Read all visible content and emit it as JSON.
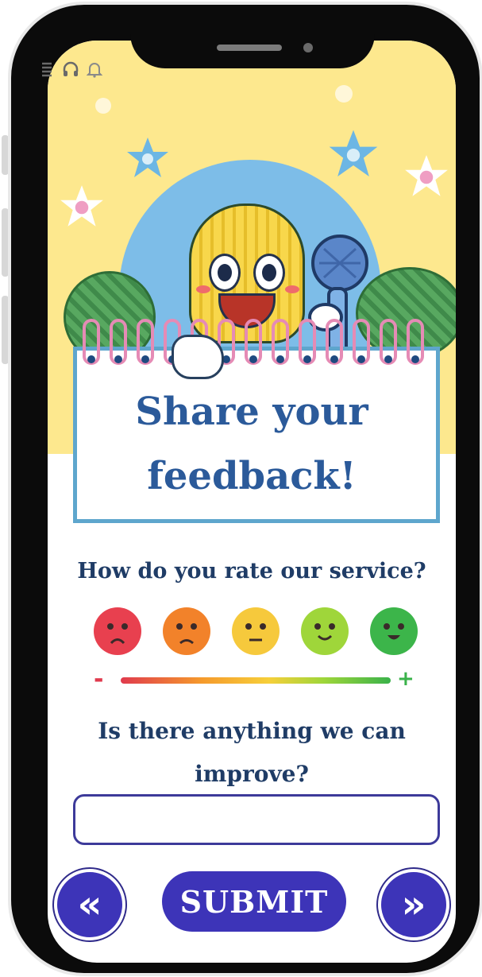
{
  "status_bar": {
    "icons": [
      "menu-icon",
      "headphones-icon",
      "bell-icon"
    ]
  },
  "card": {
    "headline_line1": "Share your",
    "headline_line2": "feedback!"
  },
  "rating": {
    "question": "How do you rate our service?",
    "faces": [
      {
        "name": "very-unhappy",
        "color": "#e8404f"
      },
      {
        "name": "unhappy",
        "color": "#f2822a"
      },
      {
        "name": "neutral",
        "color": "#f6c93c"
      },
      {
        "name": "happy",
        "color": "#9fd63a"
      },
      {
        "name": "very-happy",
        "color": "#3cb54a"
      }
    ],
    "scale_min": "-",
    "scale_max": "+"
  },
  "improve": {
    "question_line1": "Is there anything we can",
    "question_line2": "improve?",
    "value": ""
  },
  "nav": {
    "back_icon": "«",
    "forward_icon": "»",
    "submit_label": "SUBMIT"
  },
  "colors": {
    "accent": "#3d34b8",
    "headline": "#2b5a9a",
    "background_top": "#fde88e"
  }
}
